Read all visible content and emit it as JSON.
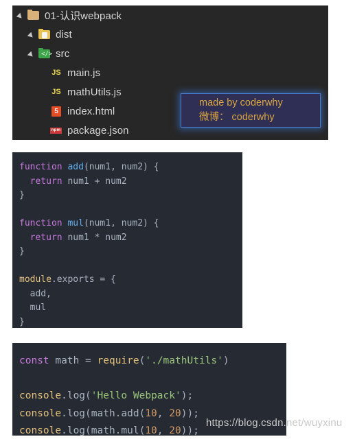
{
  "file_tree": {
    "panel_bg": "#272727",
    "items": [
      {
        "label": "01-认识webpack",
        "icon": "folder-tan-icon",
        "depth": 0,
        "expanded": true,
        "type": "folder"
      },
      {
        "label": "dist",
        "icon": "folder-yellow-dist-icon",
        "depth": 1,
        "expanded": true,
        "type": "folder"
      },
      {
        "label": "src",
        "icon": "folder-green-src-icon",
        "depth": 1,
        "expanded": true,
        "type": "folder"
      },
      {
        "label": "main.js",
        "icon": "js-file-icon",
        "depth": 2,
        "type": "file",
        "badge": "JS"
      },
      {
        "label": "mathUtils.js",
        "icon": "js-file-icon",
        "depth": 2,
        "type": "file",
        "badge": "JS"
      },
      {
        "label": "index.html",
        "icon": "html5-file-icon",
        "depth": 2,
        "type": "file",
        "badge": "5"
      },
      {
        "label": "package.json",
        "icon": "npm-file-icon",
        "depth": 2,
        "type": "file",
        "badge": "npm"
      }
    ]
  },
  "badge": {
    "line1": "made by coderwhy",
    "line2": "微博： coderwhy",
    "text_color": "#d9a441",
    "bg_color": "#2f2f55",
    "glow_color": "#4a7fd4"
  },
  "code_block_1": {
    "filename_implied": "mathUtils.js",
    "bg_color": "#262b33",
    "lines": [
      [
        {
          "t": "function ",
          "c": "kw"
        },
        {
          "t": "add",
          "c": "fn"
        },
        {
          "t": "(num1, num2) {",
          "c": "punc"
        }
      ],
      [
        {
          "t": "  ",
          "c": "punc"
        },
        {
          "t": "return",
          "c": "kw"
        },
        {
          "t": " num1 + num2",
          "c": "var"
        }
      ],
      [
        {
          "t": "}",
          "c": "punc"
        }
      ],
      [
        {
          "t": "",
          "c": "punc"
        }
      ],
      [
        {
          "t": "function ",
          "c": "kw"
        },
        {
          "t": "mul",
          "c": "fn"
        },
        {
          "t": "(num1, num2) {",
          "c": "punc"
        }
      ],
      [
        {
          "t": "  ",
          "c": "punc"
        },
        {
          "t": "return",
          "c": "kw"
        },
        {
          "t": " num1 * num2",
          "c": "var"
        }
      ],
      [
        {
          "t": "}",
          "c": "punc"
        }
      ],
      [
        {
          "t": "",
          "c": "punc"
        }
      ],
      [
        {
          "t": "module",
          "c": "gold"
        },
        {
          "t": ".exports = {",
          "c": "var"
        }
      ],
      [
        {
          "t": "  add,",
          "c": "var"
        }
      ],
      [
        {
          "t": "  mul",
          "c": "var"
        }
      ],
      [
        {
          "t": "}",
          "c": "punc"
        }
      ]
    ]
  },
  "code_block_2": {
    "filename_implied": "main.js",
    "bg_color": "#262b33",
    "lines": [
      [
        {
          "t": "const",
          "c": "kw"
        },
        {
          "t": " math ",
          "c": "var"
        },
        {
          "t": "=",
          "c": "op"
        },
        {
          "t": " ",
          "c": "var"
        },
        {
          "t": "require",
          "c": "gold"
        },
        {
          "t": "(",
          "c": "punc"
        },
        {
          "t": "'./mathUtils'",
          "c": "str"
        },
        {
          "t": ")",
          "c": "punc"
        }
      ],
      [
        {
          "t": "",
          "c": "punc"
        }
      ],
      [
        {
          "t": "console",
          "c": "gold"
        },
        {
          "t": ".log(",
          "c": "var"
        },
        {
          "t": "'Hello Webpack'",
          "c": "str"
        },
        {
          "t": ");",
          "c": "var"
        }
      ],
      [
        {
          "t": "console",
          "c": "gold"
        },
        {
          "t": ".log(math.add(",
          "c": "var"
        },
        {
          "t": "10",
          "c": "num"
        },
        {
          "t": ", ",
          "c": "var"
        },
        {
          "t": "20",
          "c": "num"
        },
        {
          "t": "));",
          "c": "var"
        }
      ],
      [
        {
          "t": "console",
          "c": "gold"
        },
        {
          "t": ".log(math.mul(",
          "c": "var"
        },
        {
          "t": "10",
          "c": "num"
        },
        {
          "t": ", ",
          "c": "var"
        },
        {
          "t": "20",
          "c": "num"
        },
        {
          "t": "));",
          "c": "var"
        }
      ]
    ]
  },
  "watermark": {
    "text": "https://blog.csdn.net/wuyxinu"
  }
}
